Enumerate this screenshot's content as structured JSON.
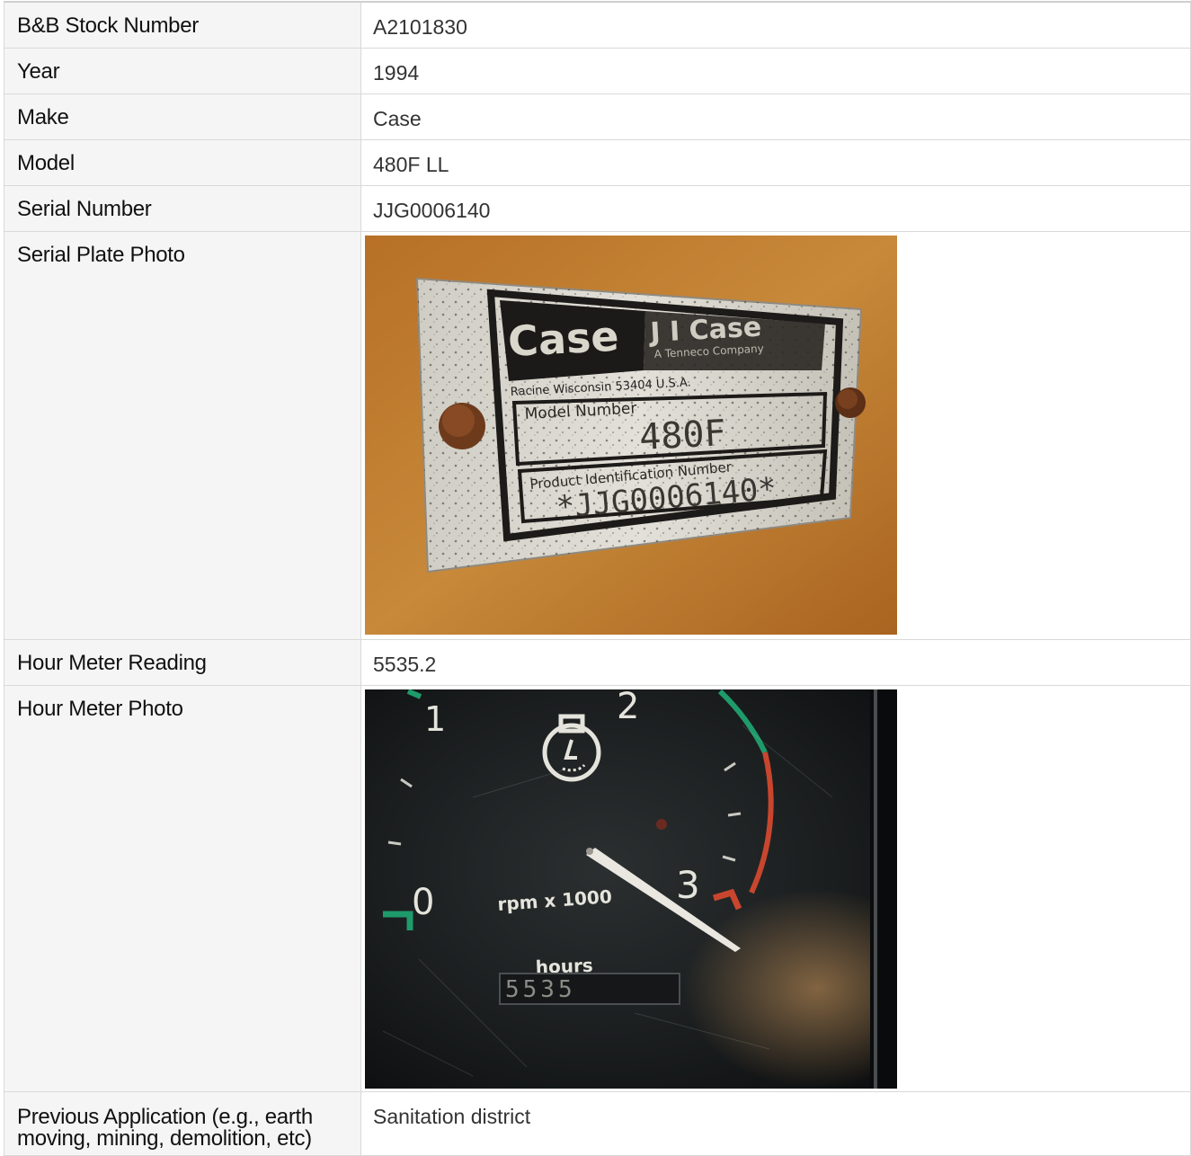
{
  "rows": [
    {
      "label": "B&B Stock Number",
      "value": "A2101830"
    },
    {
      "label": "Year",
      "value": "1994"
    },
    {
      "label": "Make",
      "value": "Case"
    },
    {
      "label": "Model",
      "value": "480F LL"
    },
    {
      "label": "Serial Number",
      "value": "JJG0006140"
    },
    {
      "label": "Serial Plate Photo"
    },
    {
      "label": "Hour Meter Reading",
      "value": "5535.2"
    },
    {
      "label": "Hour Meter Photo"
    },
    {
      "label": "Previous Application (e.g., earth moving, mining, demolition, etc)",
      "value": "Sanitation district"
    }
  ],
  "serial_plate_photo": {
    "brand": "Case",
    "brand_small": "J I Case",
    "company": "A Tenneco Company",
    "address": "Racine Wisconsin 53404 U.S.A.",
    "model_label": "Model Number",
    "model_value": "480F",
    "pin_label": "Product Identification Number",
    "pin_value": "*JJG0006140*"
  },
  "hour_meter_photo": {
    "tick_0": "0",
    "tick_1": "1",
    "tick_2": "2",
    "tick_3": "3",
    "scale_label": "rpm x 1000",
    "hours_label": "hours",
    "hours_value": "5535"
  },
  "colors": {
    "label_bg": "#f5f5f5",
    "border": "#d9d9d9",
    "plate_orange": "#c9832f",
    "gauge_green": "#1f9a6b",
    "gauge_red": "#c8462e"
  }
}
